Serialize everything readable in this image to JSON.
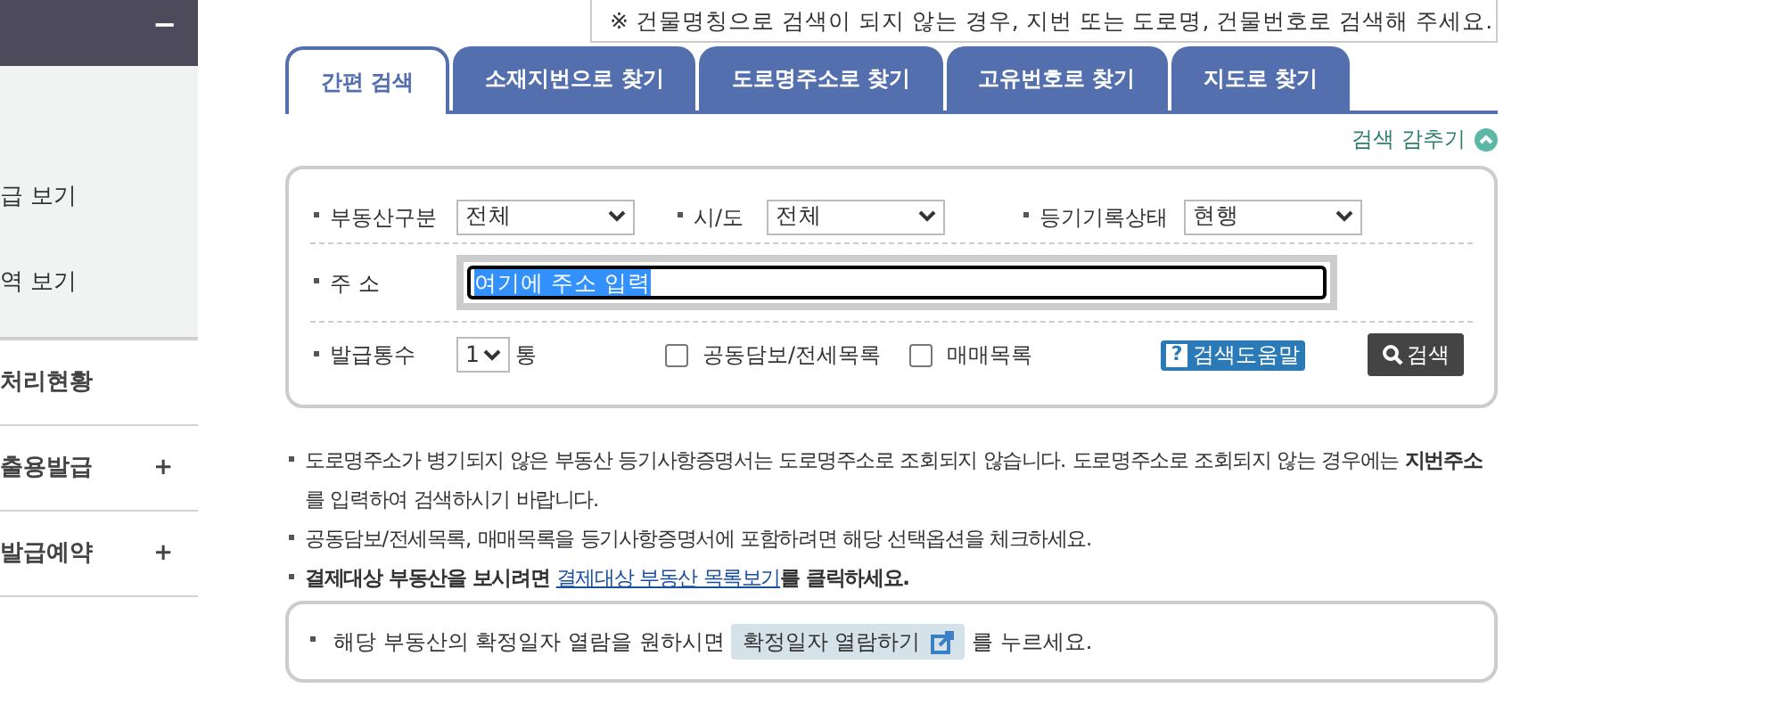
{
  "sidebar": {
    "header": {
      "toggle": "−"
    },
    "items": [
      {
        "label": "급 보기",
        "bold": false
      },
      {
        "label": "역 보기",
        "bold": false
      }
    ],
    "menu": [
      {
        "label": "처리현황"
      },
      {
        "label": "출용발급",
        "toggle": "+"
      },
      {
        "label": "발급예약",
        "toggle": "+"
      }
    ]
  },
  "notice": "※ 건물명칭으로 검색이 되지 않는 경우, 지번 또는 도로명, 건물번호로 검색해 주세요.",
  "tabs": [
    {
      "label": "간편 검색",
      "selected": true
    },
    {
      "label": "소재지번으로 찾기",
      "selected": false
    },
    {
      "label": "도로명주소로 찾기",
      "selected": false
    },
    {
      "label": "고유번호로 찾기",
      "selected": false
    },
    {
      "label": "지도로 찾기",
      "selected": false
    }
  ],
  "hide_search": "검색 감추기",
  "form": {
    "row1": [
      {
        "label": "부동산구분",
        "value": "전체"
      },
      {
        "label": "시/도",
        "value": "전체"
      },
      {
        "label": "등기기록상태",
        "value": "현행"
      }
    ],
    "address": {
      "label": "주 소",
      "value": "여기에 주소 입력",
      "selected": true
    },
    "copies": {
      "label": "발급통수",
      "value": "1",
      "unit": "통"
    },
    "checkboxes": [
      {
        "label": "공동담보/전세목록",
        "checked": false
      },
      {
        "label": "매매목록",
        "checked": false
      }
    ],
    "help": {
      "icon": "?",
      "label": "검색도움말"
    },
    "search_button": "검색"
  },
  "notes": [
    {
      "text": "도로명주소가 병기되지 않은 부동산 등기사항증명서는 도로명주소로 조회되지 않습니다. 도로명주소로 조회되지 않는 경우에는 **지번주소**를 입력하여 검색하시기 바랍니다."
    },
    {
      "text": "공동담보/전세목록, 매매목록을 등기사항증명서에 포함하려면 해당 선택옵션을 체크하세요."
    },
    {
      "prefix": "결제대상 부동산을 보시려면 ",
      "link": "결제대상 부동산 목록보기",
      "suffix": "를 클릭하세요."
    }
  ],
  "info_box": {
    "before": "해당 부동산의 확정일자 열람을 원하시면",
    "button": "확정일자 열람하기",
    "after": "를 누르세요."
  }
}
